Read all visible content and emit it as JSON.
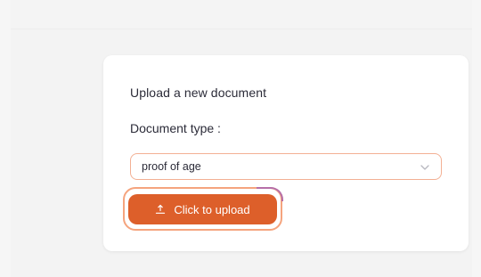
{
  "upload_card": {
    "title": "Upload a new document",
    "document_type_label": "Document type :",
    "document_type_select": {
      "selected_value": "proof of age"
    },
    "upload_button": {
      "label": "Click to upload",
      "icon": "upload-icon"
    }
  },
  "colors": {
    "accent": "#dd5f2a",
    "select_border": "#f3b094",
    "focus_ring": "#f5a47e",
    "text": "#2b2b38",
    "background": "#f6f6f6",
    "card": "#ffffff"
  }
}
